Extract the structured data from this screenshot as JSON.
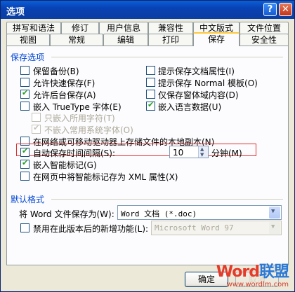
{
  "window": {
    "title": "选项",
    "help_glyph": "?",
    "close_glyph": "✕"
  },
  "tabs_row1": [
    "拼写和语法",
    "修订",
    "用户信息",
    "兼容性",
    "中文版式",
    "文件位置"
  ],
  "tabs_row2": [
    "视图",
    "常规",
    "编辑",
    "打印",
    "保存",
    "安全性"
  ],
  "active_tab": "保存",
  "save_options": {
    "group_title": "保存选项",
    "left": [
      {
        "label": "保留备份(B)",
        "checked": false
      },
      {
        "label": "允许快速保存(F)",
        "checked": false
      },
      {
        "label": "允许后台保存(A)",
        "checked": true
      },
      {
        "label": "嵌入 TrueType 字体(E)",
        "checked": false
      }
    ],
    "right": [
      {
        "label": "提示保存文档属性(I)",
        "checked": false
      },
      {
        "label": "提示保存 Normal 模板(O)",
        "checked": false
      },
      {
        "label": "仅保存窗体域内容(D)",
        "checked": false
      },
      {
        "label": "嵌入语言数据(U)",
        "checked": true
      }
    ],
    "sub_embed": [
      {
        "label": "只嵌入所用字符(T)",
        "checked": false
      },
      {
        "label": "不嵌入常用系统字体(O)",
        "checked": true
      }
    ],
    "network_copy": {
      "label": "在网络或可移动驱动器上存储文件的本地副本(N)",
      "checked": false
    },
    "autosave": {
      "label": "自动保存时间间隔(S):",
      "checked": true,
      "value": "10",
      "unit": "分钟(M)"
    },
    "smart_tags": {
      "label": "嵌入智能标记(G)",
      "checked": true
    },
    "xml_smart_tags": {
      "label": "在网页中将智能标记存为 XML 属性(X)",
      "checked": false
    }
  },
  "default_format": {
    "group_title": "默认格式",
    "save_as_label": "将 Word 文件保存为(W):",
    "save_as_value": "Word 文档 (*.doc)",
    "disable_features": {
      "label": "禁用在此版本后的新增功能(L):",
      "checked": false,
      "value": "Microsoft Word 97"
    }
  },
  "buttons": {
    "ok": "确定",
    "cancel": "取消"
  },
  "watermark": {
    "brand_a": "Word",
    "brand_b": "联盟",
    "url": "www.wordlm.com"
  }
}
